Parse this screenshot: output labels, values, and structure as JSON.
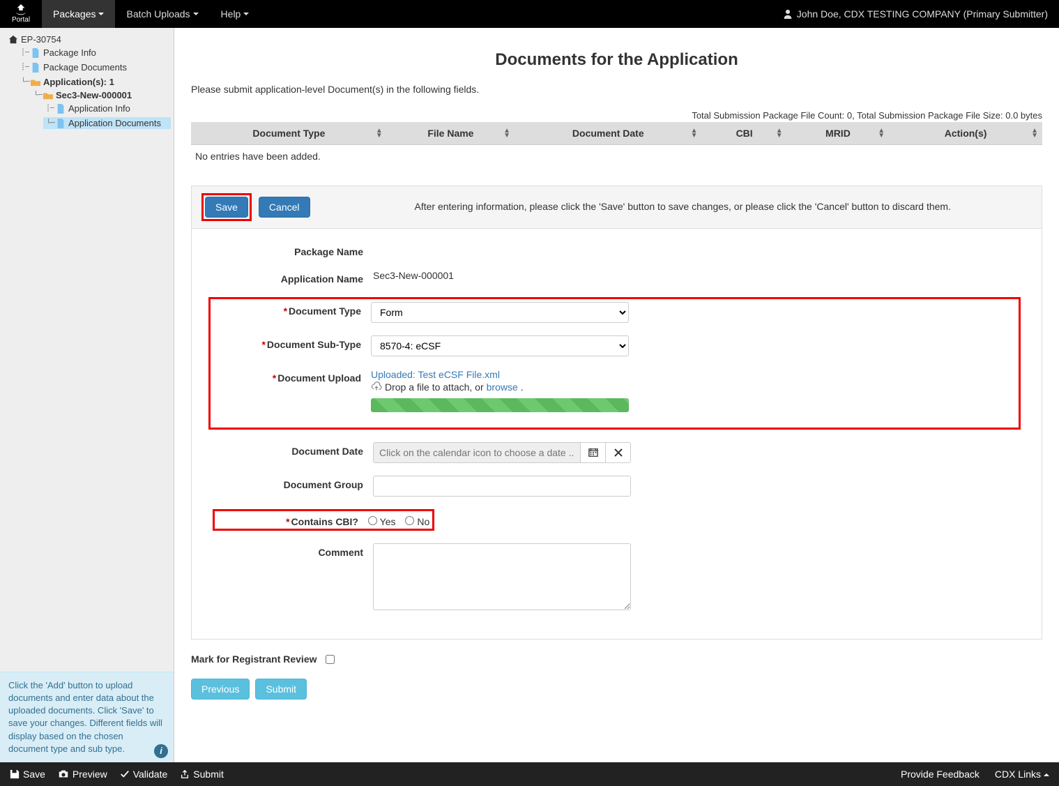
{
  "nav": {
    "items": [
      "Packages",
      "Batch Uploads",
      "Help"
    ],
    "user": "John Doe, CDX TESTING COMPANY (Primary Submitter)",
    "logo": "Portal"
  },
  "tree": {
    "root": "EP-30754",
    "items": [
      {
        "label": "Package Info"
      },
      {
        "label": "Package Documents"
      },
      {
        "label": "Application(s): 1",
        "folder": true,
        "children": [
          {
            "label": "Sec3-New-000001",
            "folder": true,
            "children": [
              {
                "label": "Application Info"
              },
              {
                "label": "Application Documents",
                "active": true
              }
            ]
          }
        ]
      }
    ]
  },
  "tip": "Click the 'Add' button to upload documents and enter data about the uploaded documents. Click 'Save' to save your changes. Different fields will display based on the chosen document type and sub type.",
  "page": {
    "title": "Documents for the Application",
    "instruction": "Please submit application-level Document(s) in the following fields.",
    "file_summary": "Total Submission Package File Count: 0, Total Submission Package File Size: 0.0 bytes",
    "columns": [
      "Document Type",
      "File Name",
      "Document Date",
      "CBI",
      "MRID",
      "Action(s)"
    ],
    "empty_msg": "No entries have been added."
  },
  "panel": {
    "save": "Save",
    "cancel": "Cancel",
    "help": "After entering information, please click the 'Save' button to save changes, or please click the 'Cancel' button to discard them."
  },
  "form": {
    "package_name_label": "Package Name",
    "package_name": "",
    "app_name_label": "Application Name",
    "app_name": "Sec3-New-000001",
    "doc_type_label": "Document Type",
    "doc_type": "Form",
    "sub_type_label": "Document Sub-Type",
    "sub_type": "8570-4: eCSF",
    "upload_label": "Document Upload",
    "uploaded_prefix": "Uploaded: ",
    "uploaded_file": "Test eCSF File.xml",
    "drop_text": "Drop a file to attach, or ",
    "browse": "browse",
    "date_label": "Document Date",
    "date_placeholder": "Click on the calendar icon to choose a date ...",
    "group_label": "Document Group",
    "cbi_label": "Contains CBI?",
    "yes": "Yes",
    "no": "No",
    "comment_label": "Comment",
    "mark_label": "Mark for Registrant Review",
    "previous": "Previous",
    "submit": "Submit"
  },
  "footer": {
    "save": "Save",
    "preview": "Preview",
    "validate": "Validate",
    "submit": "Submit",
    "feedback": "Provide Feedback",
    "links": "CDX Links"
  }
}
